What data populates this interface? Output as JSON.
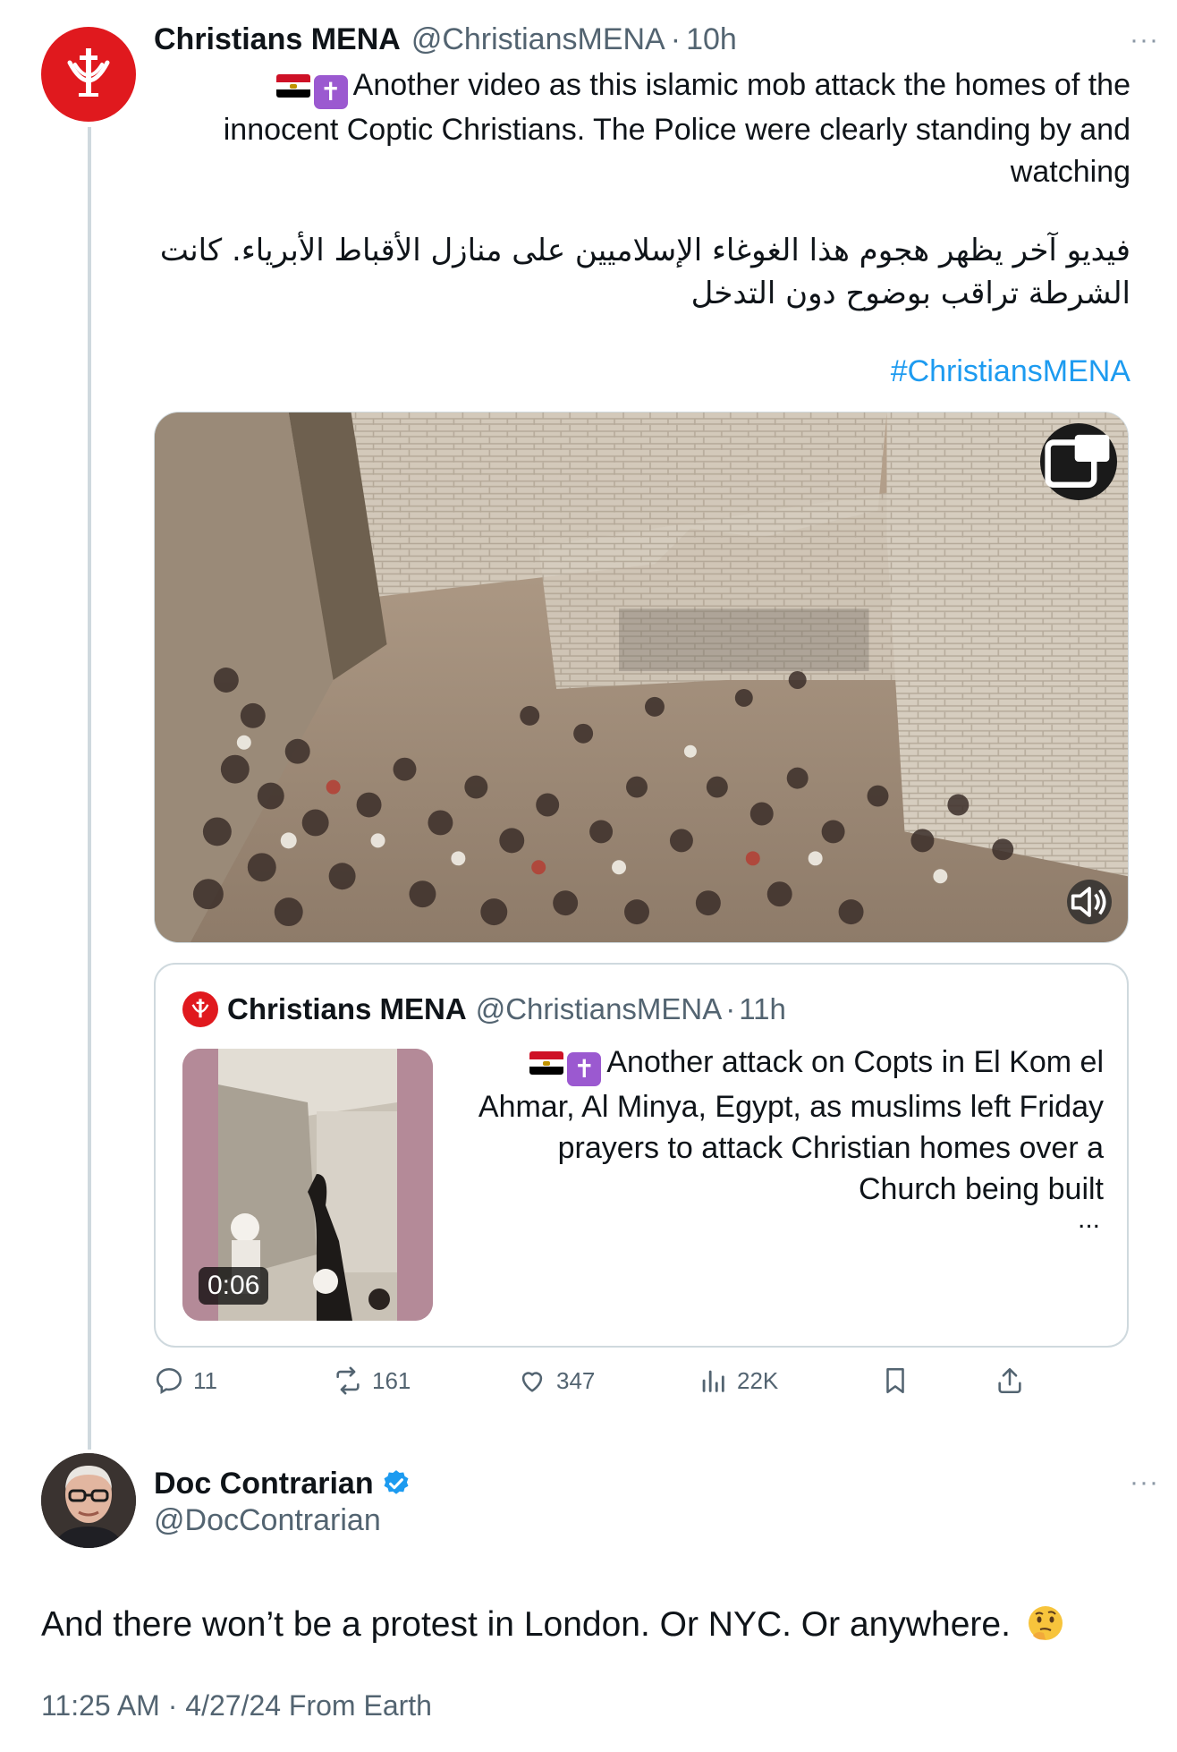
{
  "tweet1": {
    "author_name": "Christians MENA",
    "handle": "@ChristiansMENA",
    "separator": "·",
    "time": "10h",
    "more": "···",
    "text_en_line1": "Another video as this islamic mob attack the homes of the",
    "text_en_rest": "innocent Coptic Christians. The Police were clearly standing by and watching",
    "text_ar": "فيديو آخر يظهر هجوم هذا الغوغاء الإسلاميين على منازل الأقباط الأبرياء. كانت الشرطة تراقب بوضوح دون التدخل",
    "hashtag": "#ChristiansMENA",
    "emoji_flag": "egypt-flag-icon",
    "emoji_cross": "latin-cross-icon"
  },
  "quoted": {
    "author_name": "Christians MENA",
    "handle": "@ChristiansMENA",
    "separator": "·",
    "time": "11h",
    "text": "Another attack on Copts in El Kom el Ahmar, Al Minya, Egypt, as muslims left Friday prayers to attack Christian homes over a Church being built",
    "ellipsis": "...",
    "duration": "0:06"
  },
  "actions": {
    "replies": "11",
    "reposts": "161",
    "likes": "347",
    "views": "22K"
  },
  "tweet2": {
    "author_name": "Doc Contrarian",
    "handle": "@DocContrarian",
    "more": "···",
    "text": "And there won’t be a protest in London. Or NYC. Or anywhere.",
    "emoji": "thinking-face-icon",
    "time": "11:25 AM",
    "separator": "·",
    "date": "4/27/24",
    "source": "From Earth"
  },
  "colors": {
    "brand_red": "#e0191e",
    "link_blue": "#1d9bf0",
    "secondary_text": "#536471",
    "border": "#cfd9de"
  }
}
